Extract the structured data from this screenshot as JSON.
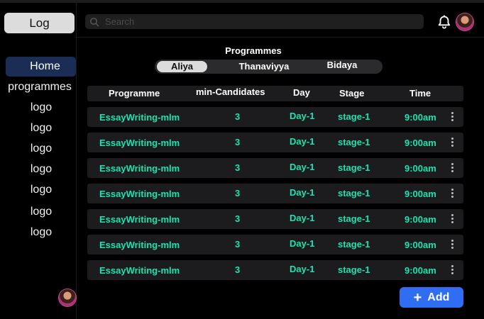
{
  "sidebar": {
    "log_label": "Log",
    "home_label": "Home",
    "items": [
      "programmes",
      "logo",
      "logo",
      "logo",
      "logo",
      "logo",
      "logo",
      "logo"
    ]
  },
  "header": {
    "search_placeholder": "Search"
  },
  "programmes": {
    "title": "Programmes",
    "tabs": [
      "Aliya",
      "Thanaviyya",
      "Bidaya"
    ],
    "active_tab": "Aliya"
  },
  "table": {
    "columns": [
      "Programme",
      "min-Candidates",
      "Day",
      "Stage",
      "Time"
    ],
    "rows": [
      [
        "EssayWriting-mlm",
        "3",
        "Day-1",
        "stage-1",
        "9:00am"
      ],
      [
        "EssayWriting-mlm",
        "3",
        "Day-1",
        "stage-1",
        "9:00am"
      ],
      [
        "EssayWriting-mlm",
        "3",
        "Day-1",
        "stage-1",
        "9:00am"
      ],
      [
        "EssayWriting-mlm",
        "3",
        "Day-1",
        "stage-1",
        "9:00am"
      ],
      [
        "EssayWriting-mlm",
        "3",
        "Day-1",
        "stage-1",
        "9:00am"
      ],
      [
        "EssayWriting-mlm",
        "3",
        "Day-1",
        "stage-1",
        "9:00am"
      ],
      [
        "EssayWriting-mlm",
        "3",
        "Day-1",
        "stage-1",
        "9:00am"
      ]
    ]
  },
  "add_label": "Add",
  "colors": {
    "accent": "#2f6df2",
    "cell_text": "#19e3b0",
    "active_nav": "#1c2d55"
  }
}
